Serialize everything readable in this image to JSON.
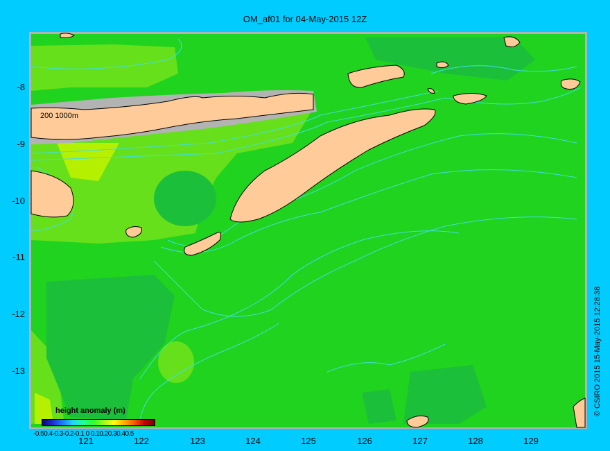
{
  "title": "OM_af01 for 04-May-2015 12Z",
  "y_ticks": [
    "-8",
    "-9",
    "-10",
    "-11",
    "-12",
    "-13"
  ],
  "x_ticks": [
    "121",
    "122",
    "123",
    "124",
    "125",
    "126",
    "127",
    "128",
    "129"
  ],
  "contour_label": "200  1000m",
  "legend": {
    "title": "height anomaly  (m)",
    "tick_labels": "-0.50.4-0.3-0.2-0.1  0  0.10.20.30.40.5"
  },
  "credit": "© CSIRO 2015   15-May-2015 12:28:38",
  "colors": {
    "background": "#00ccff",
    "ocean_base": "#1fd31f",
    "ocean_dark": "#1bbf3a",
    "ocean_light": "#66e01a",
    "ocean_yellow": "#b5f000",
    "land": "#ffcc99",
    "shelf": "#b3b3b3",
    "contour": "#40e0e0"
  }
}
